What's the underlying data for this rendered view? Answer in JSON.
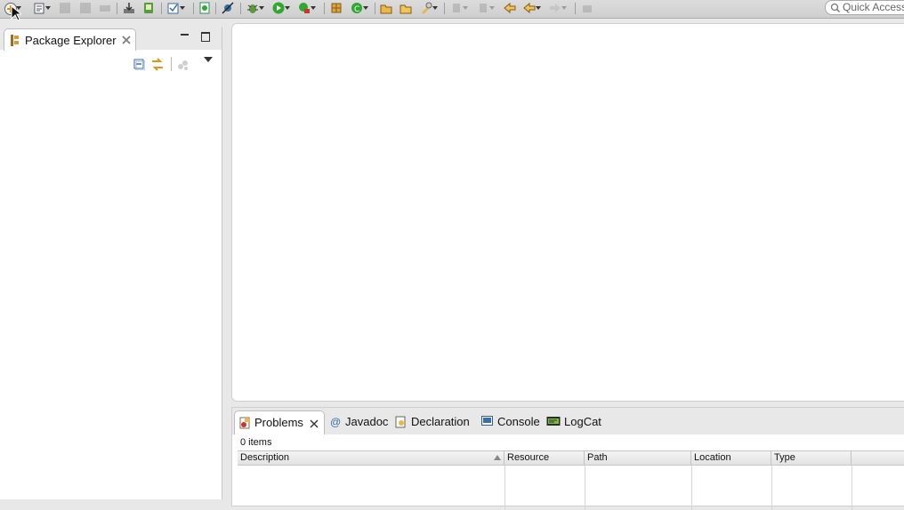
{
  "toolbar": {
    "quick_access_placeholder": "Quick Access"
  },
  "package_explorer": {
    "title": "Package Explorer"
  },
  "bottom_panel": {
    "tabs": [
      {
        "label": "Problems",
        "icon": "problems-icon"
      },
      {
        "label": "Javadoc",
        "icon": "javadoc-at-icon"
      },
      {
        "label": "Declaration",
        "icon": "declaration-icon"
      },
      {
        "label": "Console",
        "icon": "console-icon"
      },
      {
        "label": "LogCat",
        "icon": "logcat-icon"
      }
    ],
    "items_count": "0 items",
    "columns": [
      "Description",
      "Resource",
      "Path",
      "Location",
      "Type"
    ]
  },
  "colors": {
    "chrome_bg": "#e8e8e8",
    "panel_bg": "#ffffff",
    "accent_green": "#2ea82e",
    "accent_orange": "#e08a1a"
  }
}
